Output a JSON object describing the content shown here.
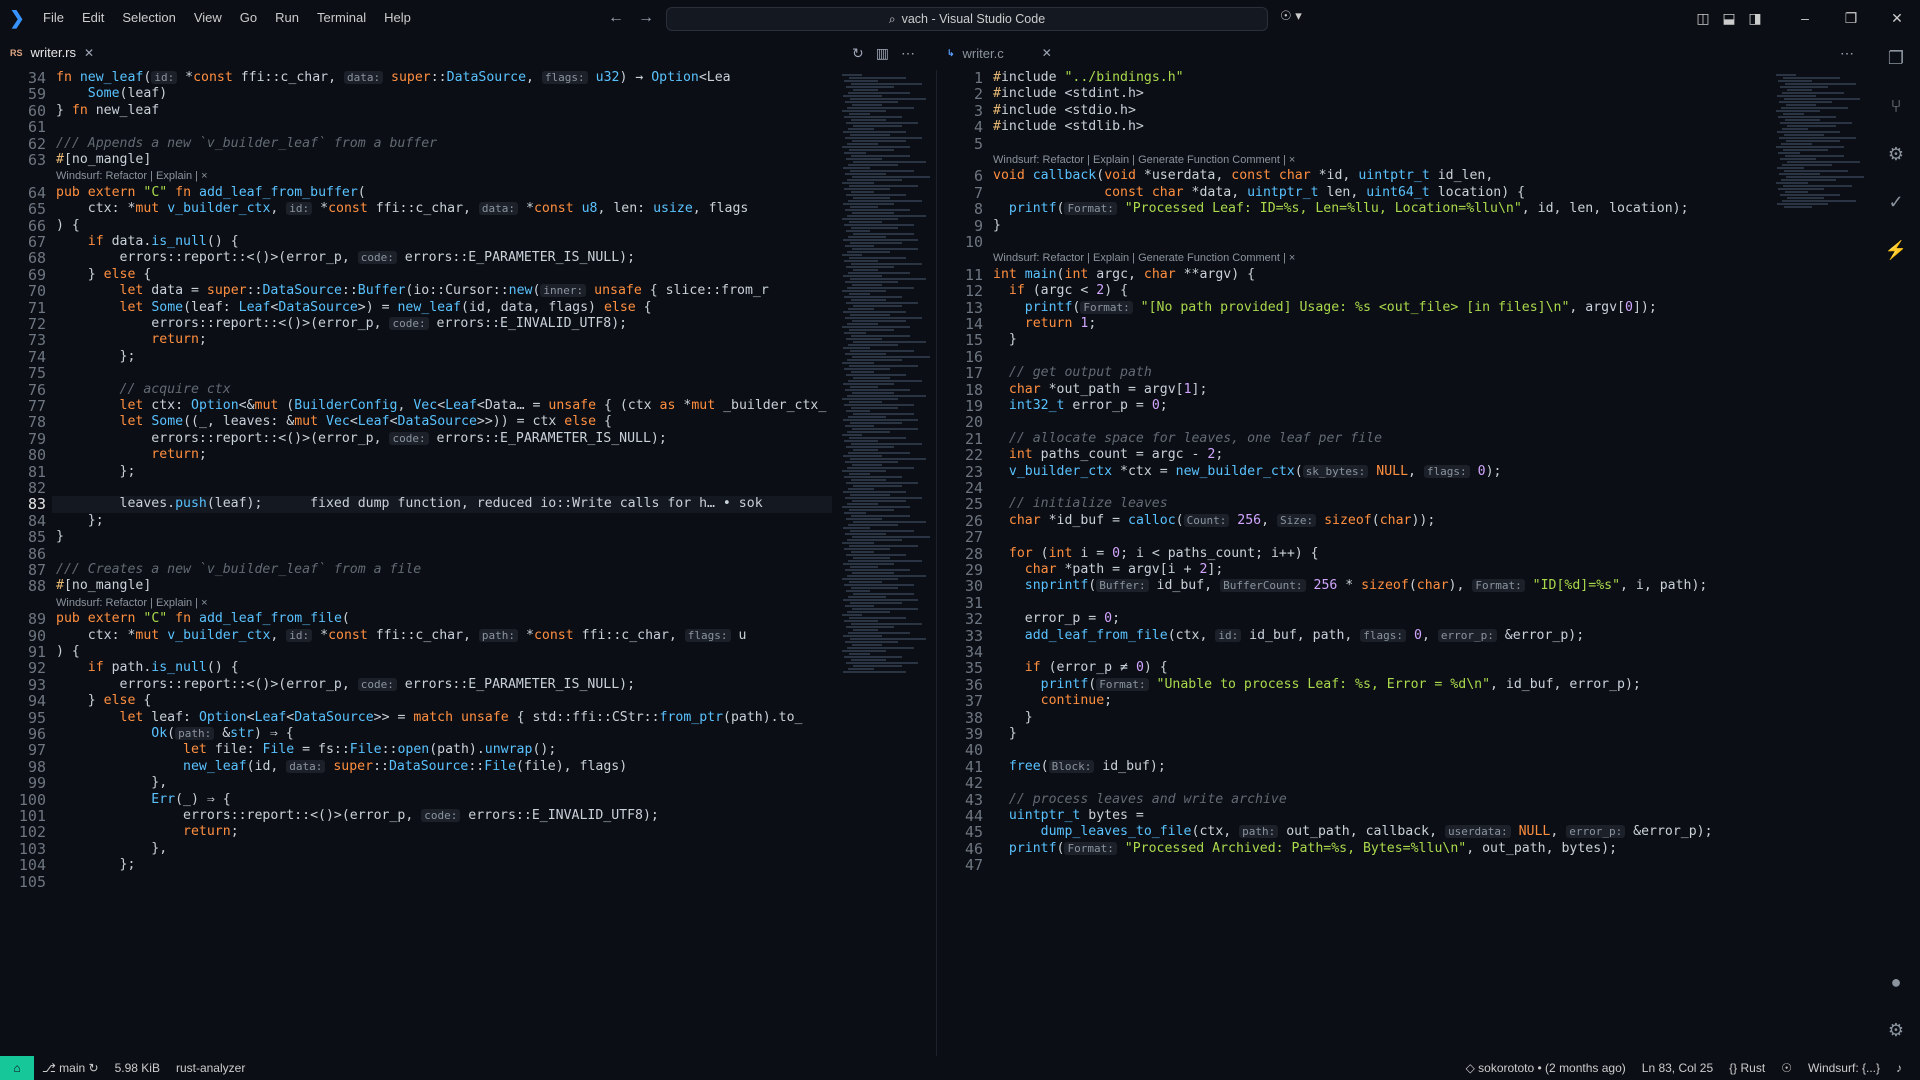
{
  "window": {
    "title": "vach - Visual Studio Code",
    "menu": [
      "File",
      "Edit",
      "Selection",
      "View",
      "Go",
      "Run",
      "Terminal",
      "Help"
    ]
  },
  "tabs_left": [
    {
      "lang": "RS",
      "label": "writer.rs",
      "active": true
    }
  ],
  "tabs_right": [
    {
      "lang": "C",
      "label": "writer.c",
      "active": false
    }
  ],
  "left_editor": {
    "lines": [
      {
        "n": "34",
        "t": "fn new_leaf(id: *const ffi::c_char, data: super::DataSource, flags: u32) → Option<Lea"
      },
      {
        "n": "59",
        "t": "    Some(leaf)"
      },
      {
        "n": "60",
        "t": "} fn new_leaf"
      },
      {
        "n": "61",
        "t": ""
      },
      {
        "n": "62",
        "t": "/// Appends a new `v_builder_leaf` from a buffer"
      },
      {
        "n": "63",
        "t": "#[no_mangle]"
      },
      {
        "n": "",
        "t": "Windsurf: Refactor | Explain | ×",
        "lens": true
      },
      {
        "n": "64",
        "t": "pub extern \"C\" fn add_leaf_from_buffer("
      },
      {
        "n": "65",
        "t": "    ctx: *mut v_builder_ctx, id: *const ffi::c_char, data: *const u8, len: usize, flags"
      },
      {
        "n": "66",
        "t": ") {"
      },
      {
        "n": "67",
        "t": "    if data.is_null() {"
      },
      {
        "n": "68",
        "t": "        errors::report::<()>(error_p, code: errors::E_PARAMETER_IS_NULL);"
      },
      {
        "n": "69",
        "t": "    } else {"
      },
      {
        "n": "70",
        "t": "        let data = super::DataSource::Buffer(io::Cursor::new(inner: unsafe { slice::from_r"
      },
      {
        "n": "71",
        "t": "        let Some(leaf: Leaf<DataSource>) = new_leaf(id, data, flags) else {"
      },
      {
        "n": "72",
        "t": "            errors::report::<()>(error_p, code: errors::E_INVALID_UTF8);"
      },
      {
        "n": "73",
        "t": "            return;"
      },
      {
        "n": "74",
        "t": "        };"
      },
      {
        "n": "75",
        "t": ""
      },
      {
        "n": "76",
        "t": "        // acquire ctx"
      },
      {
        "n": "77",
        "t": "        let ctx: Option<&mut (BuilderConfig, Vec<Leaf<Data… = unsafe { (ctx as *mut _builder_ctx_"
      },
      {
        "n": "78",
        "t": "        let Some((_, leaves: &mut Vec<Leaf<DataSource>>)) = ctx else {"
      },
      {
        "n": "79",
        "t": "            errors::report::<()>(error_p, code: errors::E_PARAMETER_IS_NULL);"
      },
      {
        "n": "80",
        "t": "            return;"
      },
      {
        "n": "81",
        "t": "        };"
      },
      {
        "n": "82",
        "t": ""
      },
      {
        "n": "83",
        "t": "        leaves.push(leaf);      fixed dump function, reduced io::Write calls for h… • sok"
      },
      {
        "n": "84",
        "t": "    };"
      },
      {
        "n": "85",
        "t": "}"
      },
      {
        "n": "86",
        "t": ""
      },
      {
        "n": "87",
        "t": "/// Creates a new `v_builder_leaf` from a file"
      },
      {
        "n": "88",
        "t": "#[no_mangle]"
      },
      {
        "n": "",
        "t": "Windsurf: Refactor | Explain | ×",
        "lens": true
      },
      {
        "n": "89",
        "t": "pub extern \"C\" fn add_leaf_from_file("
      },
      {
        "n": "90",
        "t": "    ctx: *mut v_builder_ctx, id: *const ffi::c_char, path: *const ffi::c_char, flags: u"
      },
      {
        "n": "91",
        "t": ") {"
      },
      {
        "n": "92",
        "t": "    if path.is_null() {"
      },
      {
        "n": "93",
        "t": "        errors::report::<()>(error_p, code: errors::E_PARAMETER_IS_NULL);"
      },
      {
        "n": "94",
        "t": "    } else {"
      },
      {
        "n": "95",
        "t": "        let leaf: Option<Leaf<DataSource>> = match unsafe { std::ffi::CStr::from_ptr(path).to_"
      },
      {
        "n": "96",
        "t": "            Ok(path: &str) ⇒ {"
      },
      {
        "n": "97",
        "t": "                let file: File = fs::File::open(path).unwrap();"
      },
      {
        "n": "98",
        "t": "                new_leaf(id, data: super::DataSource::File(file), flags)"
      },
      {
        "n": "99",
        "t": "            },"
      },
      {
        "n": "100",
        "t": "            Err(_) ⇒ {"
      },
      {
        "n": "101",
        "t": "                errors::report::<()>(error_p, code: errors::E_INVALID_UTF8);"
      },
      {
        "n": "102",
        "t": "                return;"
      },
      {
        "n": "103",
        "t": "            },"
      },
      {
        "n": "104",
        "t": "        };"
      },
      {
        "n": "105",
        "t": ""
      }
    ],
    "current_line": "83"
  },
  "right_editor": {
    "lines": [
      {
        "n": "1",
        "t": "#include \"../bindings.h\""
      },
      {
        "n": "2",
        "t": "#include <stdint.h>"
      },
      {
        "n": "3",
        "t": "#include <stdio.h>"
      },
      {
        "n": "4",
        "t": "#include <stdlib.h>"
      },
      {
        "n": "5",
        "t": ""
      },
      {
        "n": "",
        "t": "Windsurf: Refactor | Explain | Generate Function Comment | ×",
        "lens": true
      },
      {
        "n": "6",
        "t": "void callback(void *userdata, const char *id, uintptr_t id_len,"
      },
      {
        "n": "7",
        "t": "              const char *data, uintptr_t len, uint64_t location) {"
      },
      {
        "n": "8",
        "t": "  printf(Format: \"Processed Leaf: ID=%s, Len=%llu, Location=%llu\\n\", id, len, location);"
      },
      {
        "n": "9",
        "t": "}"
      },
      {
        "n": "10",
        "t": ""
      },
      {
        "n": "",
        "t": "Windsurf: Refactor | Explain | Generate Function Comment | ×",
        "lens": true
      },
      {
        "n": "11",
        "t": "int main(int argc, char **argv) {"
      },
      {
        "n": "12",
        "t": "  if (argc < 2) {"
      },
      {
        "n": "13",
        "t": "    printf(Format: \"[No path provided] Usage: %s <out_file> [in files]\\n\", argv[0]);"
      },
      {
        "n": "14",
        "t": "    return 1;"
      },
      {
        "n": "15",
        "t": "  }"
      },
      {
        "n": "16",
        "t": ""
      },
      {
        "n": "17",
        "t": "  // get output path"
      },
      {
        "n": "18",
        "t": "  char *out_path = argv[1];"
      },
      {
        "n": "19",
        "t": "  int32_t error_p = 0;"
      },
      {
        "n": "20",
        "t": ""
      },
      {
        "n": "21",
        "t": "  // allocate space for leaves, one leaf per file"
      },
      {
        "n": "22",
        "t": "  int paths_count = argc - 2;"
      },
      {
        "n": "23",
        "t": "  v_builder_ctx *ctx = new_builder_ctx(sk_bytes: NULL, flags: 0);"
      },
      {
        "n": "24",
        "t": ""
      },
      {
        "n": "25",
        "t": "  // initialize leaves"
      },
      {
        "n": "26",
        "t": "  char *id_buf = calloc(Count: 256, Size: sizeof(char));"
      },
      {
        "n": "27",
        "t": ""
      },
      {
        "n": "28",
        "t": "  for (int i = 0; i < paths_count; i++) {"
      },
      {
        "n": "29",
        "t": "    char *path = argv[i + 2];"
      },
      {
        "n": "30",
        "t": "    snprintf(Buffer: id_buf, BufferCount: 256 * sizeof(char), Format: \"ID[%d]=%s\", i, path);"
      },
      {
        "n": "31",
        "t": ""
      },
      {
        "n": "32",
        "t": "    error_p = 0;"
      },
      {
        "n": "33",
        "t": "    add_leaf_from_file(ctx, id: id_buf, path, flags: 0, error_p: &error_p);"
      },
      {
        "n": "34",
        "t": ""
      },
      {
        "n": "35",
        "t": "    if (error_p ≠ 0) {"
      },
      {
        "n": "36",
        "t": "      printf(Format: \"Unable to process Leaf: %s, Error = %d\\n\", id_buf, error_p);"
      },
      {
        "n": "37",
        "t": "      continue;"
      },
      {
        "n": "38",
        "t": "    }"
      },
      {
        "n": "39",
        "t": "  }"
      },
      {
        "n": "40",
        "t": ""
      },
      {
        "n": "41",
        "t": "  free(Block: id_buf);"
      },
      {
        "n": "42",
        "t": ""
      },
      {
        "n": "43",
        "t": "  // process leaves and write archive"
      },
      {
        "n": "44",
        "t": "  uintptr_t bytes ="
      },
      {
        "n": "45",
        "t": "      dump_leaves_to_file(ctx, path: out_path, callback, userdata: NULL, error_p: &error_p);"
      },
      {
        "n": "46",
        "t": "  printf(Format: \"Processed Archived: Path=%s, Bytes=%llu\\n\", out_path, bytes);"
      },
      {
        "n": "47",
        "t": ""
      }
    ]
  },
  "statusbar": {
    "branch": "main",
    "size": "5.98 KiB",
    "lsp": "rust-analyzer",
    "blame": "sokorototo • (2 months ago)",
    "position": "Ln 83, Col 25",
    "language": "Rust",
    "assistant": "Windsurf: {...}"
  },
  "colors": {
    "accent": "#16c79a",
    "background": "#0b0e14",
    "link": "#3794ff"
  }
}
